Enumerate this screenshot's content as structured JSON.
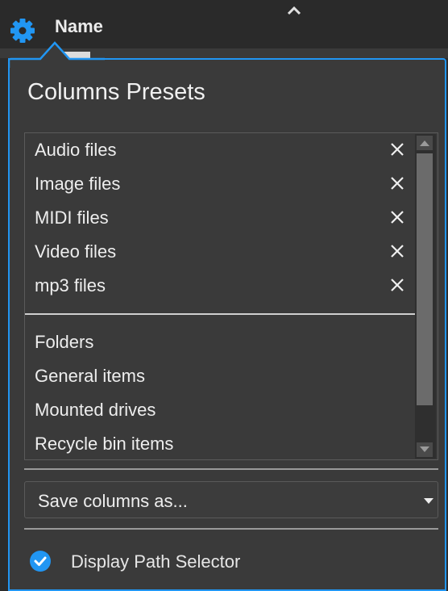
{
  "header": {
    "column_name": "Name",
    "gear_icon": "gear-icon",
    "sort_icon": "chevron-up-icon"
  },
  "popup": {
    "title": "Columns Presets",
    "user_presets": [
      {
        "label": "Audio files",
        "delete_icon": "close-icon"
      },
      {
        "label": "Image files",
        "delete_icon": "close-icon"
      },
      {
        "label": "MIDI files",
        "delete_icon": "close-icon"
      },
      {
        "label": "Video files",
        "delete_icon": "close-icon"
      },
      {
        "label": "mp3 files",
        "delete_icon": "close-icon"
      }
    ],
    "builtin_presets": [
      {
        "label": "Folders"
      },
      {
        "label": "General items"
      },
      {
        "label": "Mounted drives"
      },
      {
        "label": "Recycle bin items"
      }
    ],
    "save_dropdown": {
      "label": "Save columns as...",
      "icon": "caret-down-icon"
    },
    "display_path_selector": {
      "label": "Display Path Selector",
      "checked": true,
      "icon": "check-circle-icon"
    }
  },
  "colors": {
    "accent": "#2196f3",
    "panel": "#3a3a3a",
    "header": "#2a2a2a"
  }
}
